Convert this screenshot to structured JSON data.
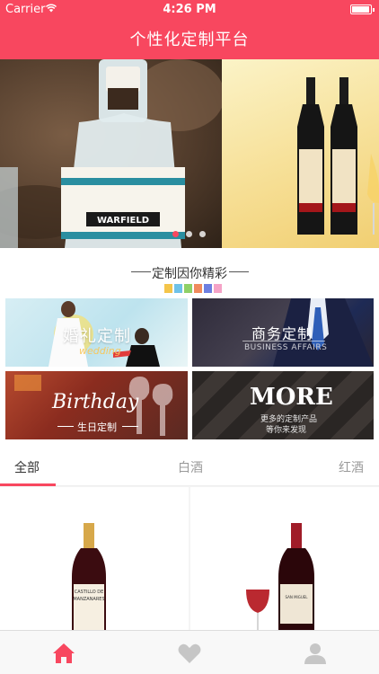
{
  "status_bar": {
    "carrier": "Carrier",
    "time": "4:26 PM",
    "battery_level": 0.95
  },
  "header": {
    "title": "个性化定制平台",
    "color": "#f8475f"
  },
  "banner": {
    "active_dot": 0,
    "dot_count": 3
  },
  "section": {
    "title": "定制因你精彩",
    "palette": [
      "#f4c54a",
      "#6fc2e8",
      "#8fd067",
      "#f08a5d",
      "#6d7fe0",
      "#f5a3c7"
    ]
  },
  "categories": {
    "wedding": {
      "label": "婚礼定制",
      "sub": "wedding"
    },
    "business": {
      "label": "商务定制",
      "sub": "BUSINESS AFFAIRS"
    },
    "birthday": {
      "label": "Birthday",
      "sub": "生日定制"
    },
    "more": {
      "label": "MORE",
      "sub1": "更多的定制产品",
      "sub2": "等你来发现"
    }
  },
  "tabs": {
    "all": "全部",
    "white": "白酒",
    "red": "红酒",
    "active": "all"
  },
  "products": [
    {
      "label_line1": "CASTILLO DE",
      "label_line2": "MANZANARES"
    },
    {
      "label_line1": "SAN MIGUEL"
    }
  ],
  "tabbar": {
    "items": [
      "home-icon",
      "heart-icon",
      "user-icon"
    ],
    "active": "home-icon"
  }
}
